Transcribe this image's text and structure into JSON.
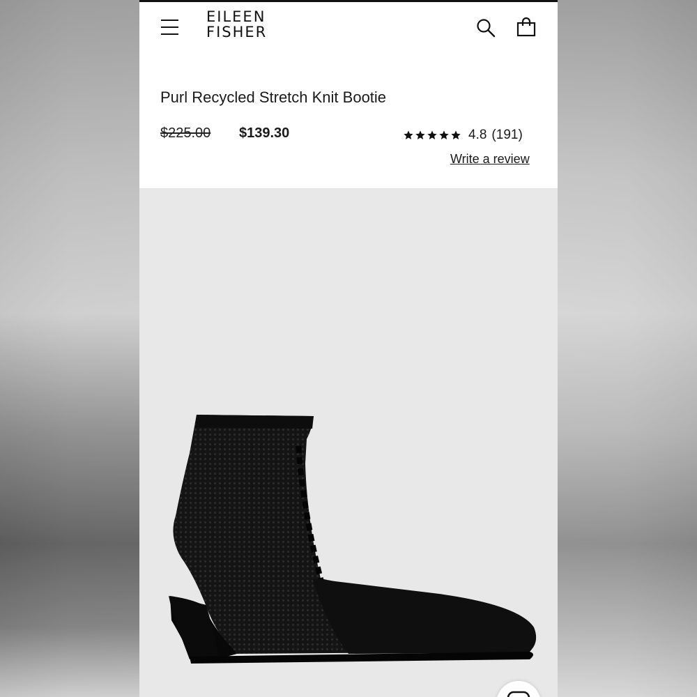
{
  "header": {
    "brand_line1": "EILEEN",
    "brand_line2": "FISHER",
    "icons": [
      "menu-icon",
      "search-icon",
      "shopping-bag-icon"
    ]
  },
  "product": {
    "title": "Purl Recycled Stretch Knit Bootie",
    "original_price": "$225.00",
    "sale_price": "$139.30",
    "rating": {
      "stars": 5,
      "value": "4.8",
      "count": "(191)",
      "write_review_label": "Write a review"
    },
    "image": {
      "description_icon": "black-knit-ankle-bootie-image",
      "background_color": "#e8e8e8"
    }
  },
  "colors": {
    "text": "#1a1a1a",
    "background": "#ffffff",
    "image_bg": "#e8e8e8",
    "product": "#111111"
  },
  "chat": {
    "icon": "chat-icon"
  }
}
